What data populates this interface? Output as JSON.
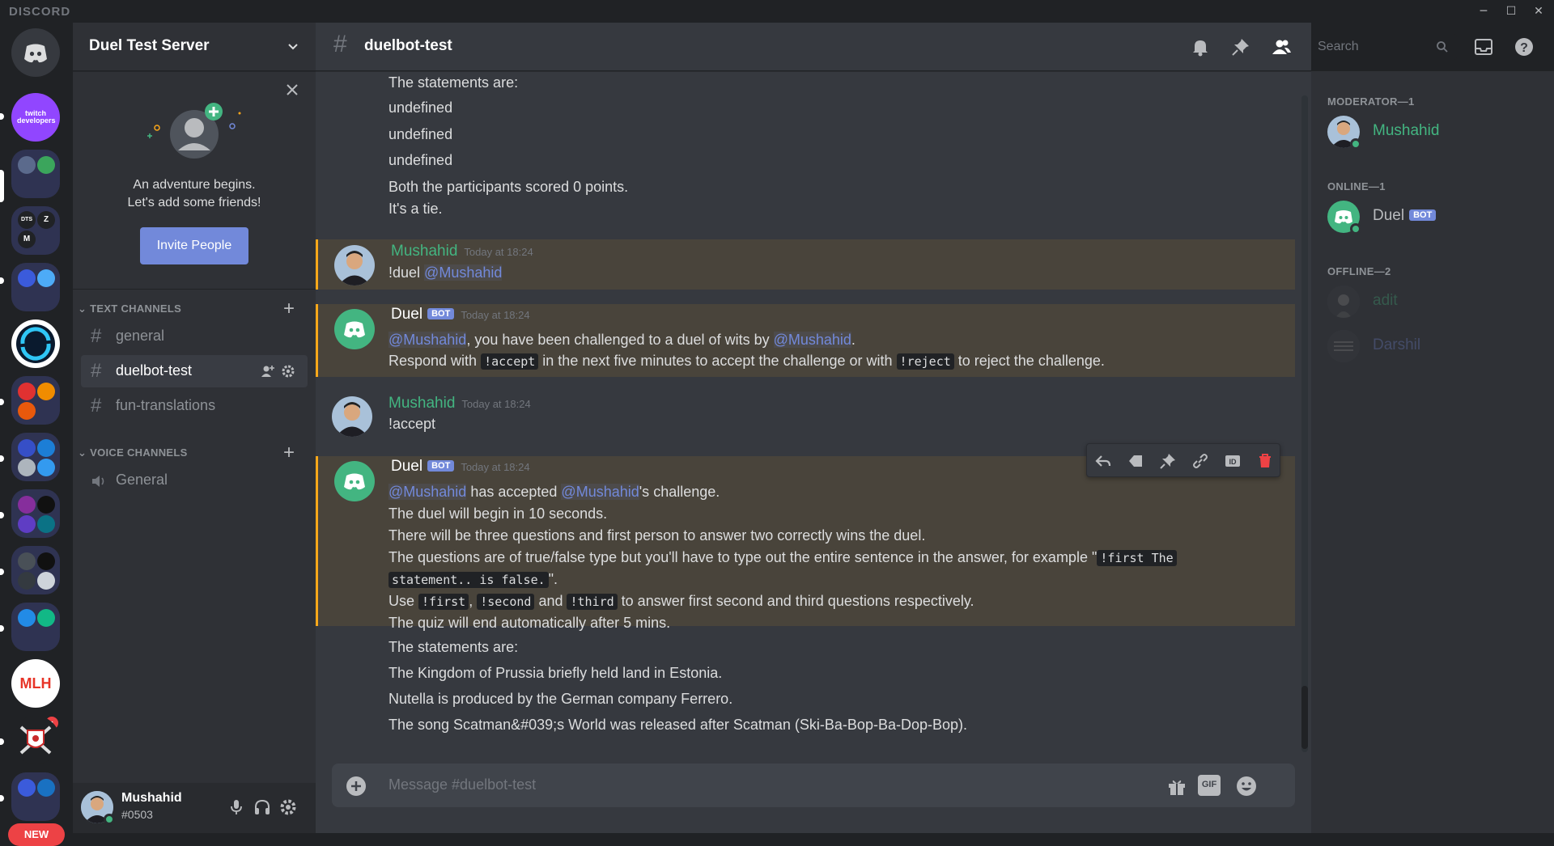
{
  "app": {
    "brand": "DISCORD",
    "win_minimize": "─",
    "win_maximize": "☐",
    "win_close": "✕"
  },
  "rail": {
    "folder_1_labels": [
      "DTS",
      "Z",
      "M"
    ],
    "mlh_badge": "1",
    "mlh_label": "MLH",
    "twitch_label": "twitch developers",
    "new_label": "NEW"
  },
  "server": {
    "name": "Duel Test Server"
  },
  "invite": {
    "line1": "An adventure begins.",
    "line2": "Let's add some friends!",
    "button": "Invite People"
  },
  "categories": {
    "text": "TEXT CHANNELS",
    "voice": "VOICE CHANNELS"
  },
  "channels": {
    "text": [
      {
        "name": "general",
        "active": false
      },
      {
        "name": "duelbot-test",
        "active": true
      },
      {
        "name": "fun-translations",
        "active": false
      }
    ],
    "voice": [
      {
        "name": "General"
      }
    ]
  },
  "user": {
    "name": "Mushahid",
    "tag": "#0503"
  },
  "header": {
    "channel": "duelbot-test",
    "search_placeholder": "Search"
  },
  "messages": {
    "top_block": [
      "The statements are:",
      "undefined",
      "undefined",
      "undefined",
      "Both the participants scored 0 points.",
      "It's a tie."
    ],
    "m1": {
      "author": "Mushahid",
      "time": "Today at 18:24",
      "text": "!duel ",
      "mention": "@Mushahid"
    },
    "m2": {
      "author": "Duel",
      "bot": "BOT",
      "time": "Today at 18:24",
      "mention1": "@Mushahid",
      "t1": ", you have been challenged to a duel of wits by ",
      "mention2": "@Mushahid",
      "t2": ".",
      "r1": "Respond with ",
      "c1": "!accept",
      "r2": " in the next five minutes to accept the challenge or with ",
      "c2": "!reject",
      "r3": " to reject the challenge."
    },
    "m3": {
      "author": "Mushahid",
      "time": "Today at 18:24",
      "text": "!accept"
    },
    "m4": {
      "author": "Duel",
      "bot": "BOT",
      "time": "Today at 18:24",
      "mention1": "@Mushahid",
      "a1": " has accepted ",
      "mention2": "@Mushahid",
      "a2": "'s challenge.",
      "l2": "The duel will begin in 10 seconds.",
      "l3": "There will be three questions and first person to answer two correctly wins the duel.",
      "l4a": "The questions are of true/false type but you'll have to type out the entire sentence in the answer, for example \"",
      "l4code": "!first The",
      "l5code": "statement.. is false.",
      "l5b": "\".",
      "u1": "Use ",
      "uc1": "!first",
      "u2": ", ",
      "uc2": "!second",
      "u3": " and ",
      "uc3": "!third",
      "u4": " to answer first second and third questions respectively.",
      "l7": "The quiz will end automatically after 5 mins."
    },
    "bottom_block": [
      "The statements are:",
      "The Kingdom of Prussia briefly held land in Estonia.",
      "Nutella is produced by the German company Ferrero.",
      "The song Scatman&#039;s World was released after Scatman (Ski-Ba-Bop-Ba-Dop-Bop)."
    ]
  },
  "composer": {
    "placeholder": "Message #duelbot-test",
    "gif": "GIF"
  },
  "members": {
    "moderator_header": "MODERATOR—1",
    "online_header": "ONLINE—1",
    "offline_header": "OFFLINE—2",
    "moderator": [
      {
        "name": "Mushahid",
        "color": "#43b581"
      }
    ],
    "online": [
      {
        "name": "Duel",
        "bot": "BOT"
      }
    ],
    "offline": [
      {
        "name": "adit"
      },
      {
        "name": "Darshil"
      }
    ]
  },
  "colors": {
    "accent": "#7289da",
    "online": "#43b581",
    "highlight": "#faa81a",
    "danger": "#ed4245"
  }
}
